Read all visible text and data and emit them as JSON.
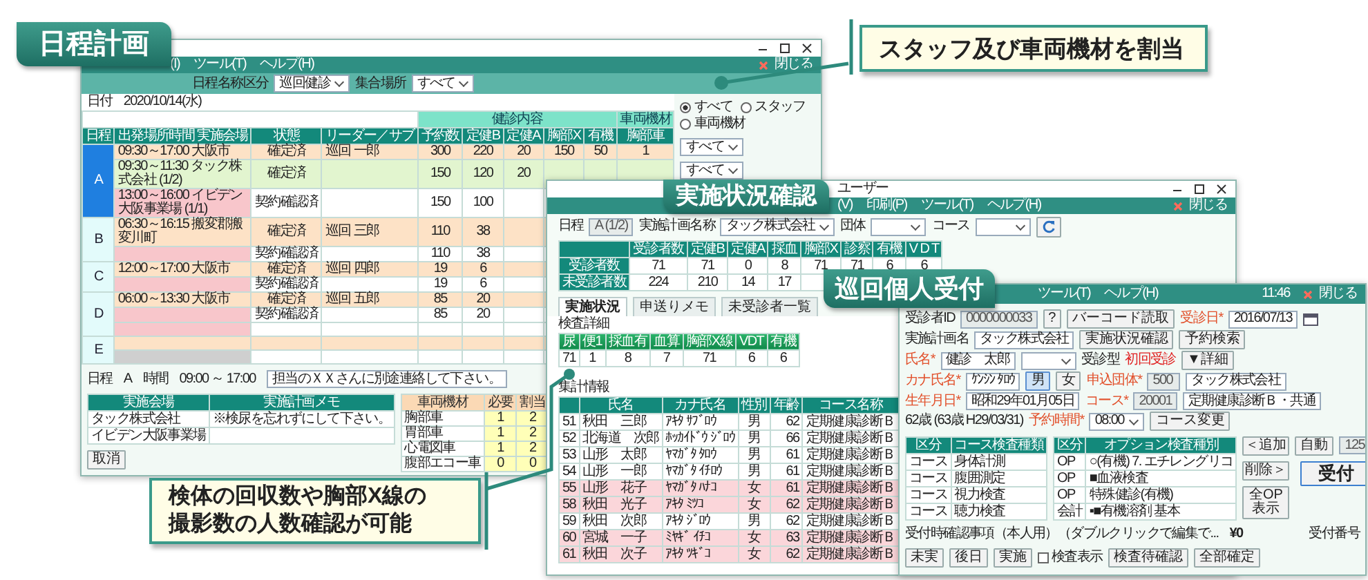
{
  "labels": [
    {
      "text": "日程計画"
    },
    {
      "text": "実施状況確認"
    },
    {
      "text": "巡回個人受付"
    }
  ],
  "callouts": [
    {
      "lines": [
        "スタッフ及び車両機材を割当"
      ]
    },
    {
      "lines": [
        "検体の回収数や胸部X線の",
        "撮影数の人数確認が可能"
      ]
    }
  ],
  "schedule_window": {
    "menu": [
      "(I)",
      "ツール(T)",
      "ヘルプ(H)"
    ],
    "close": "閉じる",
    "toolbar": [
      {
        "kind": "label",
        "text": "日程名称区分"
      },
      {
        "kind": "select",
        "text": "巡回健診"
      },
      {
        "kind": "label",
        "text": "集合場所"
      },
      {
        "kind": "select",
        "text": "すべて"
      }
    ],
    "date_label": "日付",
    "date": "2020/10/14(水)",
    "columns": [
      "日程",
      "出発場所時間 実施会場",
      "状態",
      "リーダー／サブ"
    ],
    "column_groups": [
      {
        "label": "健診内容",
        "columns": [
          "予約数",
          "定健B",
          "定健A",
          "胸部X",
          "有機"
        ]
      },
      {
        "label": "車両機材",
        "columns": [
          "胸部車"
        ]
      }
    ],
    "days": [
      {
        "day": "A",
        "selected": true,
        "rows": [
          {
            "kind": "summary",
            "selected": false,
            "venue": "09:30～17:00 大阪市",
            "status": "確定済",
            "leader": "巡回 一郎",
            "values": [
              "300",
              "220",
              "20",
              "150",
              "50",
              "1"
            ]
          },
          {
            "kind": "plan",
            "selected": true,
            "venue": "09:30～11:30 タック株式会社 (1/2)",
            "status": "確定済",
            "values": [
              "150",
              "120",
              "20"
            ]
          },
          {
            "kind": "plan",
            "selected": false,
            "venue": "13:00～16:00 イビデン大阪事業場 (1/1)",
            "status": "契約確認済",
            "values": [
              "150",
              "100"
            ]
          }
        ]
      },
      {
        "day": "B",
        "selected": false,
        "rows": [
          {
            "kind": "summary",
            "selected": false,
            "venue": "06:30～16:15 搬変郡搬変川町",
            "status": "確定済",
            "leader": "巡回 三郎",
            "values": [
              "110",
              "38"
            ]
          },
          {
            "kind": "plan",
            "selected": false,
            "status": "契約確認済",
            "values": [
              "110",
              "38"
            ]
          }
        ]
      },
      {
        "day": "C",
        "selected": false,
        "rows": [
          {
            "kind": "summary",
            "selected": false,
            "venue": "12:00～17:00 大阪市",
            "status": "確定済",
            "leader": "巡回 四郎",
            "values": [
              "19",
              "6"
            ]
          },
          {
            "kind": "plan",
            "selected": false,
            "status": "契約確認済",
            "values": [
              "19",
              "6"
            ]
          }
        ]
      },
      {
        "day": "D",
        "selected": false,
        "rows": [
          {
            "kind": "summary",
            "selected": false,
            "venue": "06:00～13:30 大阪市",
            "status": "確定済",
            "leader": "巡回 五郎",
            "values": [
              "85",
              "20"
            ]
          },
          {
            "kind": "plan",
            "selected": false,
            "status": "契約確認済",
            "values": [
              "85",
              "20"
            ]
          },
          {
            "kind": "plan",
            "selected": false
          }
        ]
      },
      {
        "day": "E",
        "selected": false,
        "rows": [
          {
            "kind": "summary",
            "selected": false
          },
          {
            "kind": "empty",
            "selected": false
          }
        ]
      }
    ],
    "filter_panel": {
      "radios": [
        {
          "label": "すべて",
          "selected": true
        },
        {
          "label": "スタッフ",
          "selected": false
        },
        {
          "label": "車両機材",
          "selected": false
        }
      ],
      "selects": [
        "すべて",
        "すべて"
      ]
    },
    "info": {
      "day_label": "日程",
      "day": "A",
      "time_label": "時間",
      "time": "09:00 ～ 17:00",
      "memo": "担当のＸＸさんに別途連絡して下さい。"
    },
    "venues": {
      "columns": [
        "実施会場",
        "実施計画メモ"
      ],
      "rows": [
        {
          "venue": "タック株式会社",
          "memo": "※検尿を忘れずにして下さい。"
        },
        {
          "venue": "イビデン大阪事業場"
        }
      ]
    },
    "equipment": {
      "columns": [
        "車両機材",
        "必要",
        "割当"
      ],
      "rows": [
        [
          "胸部車",
          "1",
          "2"
        ],
        [
          "胃部車",
          "1",
          "2"
        ],
        [
          "心電図車",
          "1",
          "2"
        ],
        [
          "腹部エコー車",
          "0",
          "0"
        ]
      ]
    },
    "cancel": "取消"
  },
  "status_window": {
    "title": "ユーザー",
    "menu": [
      "(V)",
      "印刷(P)",
      "ツール(T)",
      "ヘルプ(H)"
    ],
    "close": "閉じる",
    "toolbar": [
      {
        "kind": "label",
        "text": "日程"
      },
      {
        "kind": "readonly",
        "text": "A (1/2)"
      },
      {
        "kind": "label",
        "text": "実施計画名称"
      },
      {
        "kind": "select",
        "text": "タック株式会社"
      },
      {
        "kind": "label",
        "text": "団体"
      },
      {
        "kind": "select"
      },
      {
        "kind": "label",
        "text": "コース"
      },
      {
        "kind": "select"
      },
      {
        "kind": "refresh"
      }
    ],
    "summary": {
      "columns": [
        "受診者数",
        "定健B",
        "定健A",
        "採血",
        "胸部X",
        "診察",
        "有機",
        "V D T"
      ],
      "rows": [
        {
          "label": "受診者数",
          "values": [
            "71",
            "71",
            "0",
            "8",
            "71",
            "71",
            "6",
            "6"
          ]
        },
        {
          "label": "未受診者数",
          "values": [
            "224",
            "210",
            "14",
            "17"
          ]
        }
      ]
    },
    "tabs": [
      {
        "label": "実施状況",
        "selected": true
      },
      {
        "label": "申送りメモ",
        "selected": false
      },
      {
        "label": "未受診者一覧",
        "selected": false
      }
    ],
    "detail": {
      "title": "検査詳細",
      "columns": [
        "尿",
        "便1",
        "採血有",
        "血算",
        "胸部X線",
        "VDT",
        "有機"
      ],
      "values": [
        "71",
        "1",
        "8",
        "7",
        "71",
        "6",
        "6"
      ]
    },
    "aggregate": {
      "title": "集計情報",
      "columns": [
        "氏名",
        "カナ氏名",
        "性別",
        "年齢",
        "コース名称"
      ],
      "rows": [
        {
          "no": "51",
          "name": "秋田　三郎",
          "kana": "ｱｷﾀ ｻﾌﾞﾛｳ",
          "sex": "男",
          "age": "62",
          "course": "定期健康診断Ｂ",
          "highlighted": false
        },
        {
          "no": "52",
          "name": "北海道　次郎",
          "kana": "ﾎｯｶｲﾄﾞｳ ｼﾞﾛｳ",
          "sex": "男",
          "age": "66",
          "course": "定期健康診断Ｂ",
          "highlighted": false
        },
        {
          "no": "53",
          "name": "山形　太郎",
          "kana": "ﾔﾏｶﾞﾀ ﾀﾛｳ",
          "sex": "男",
          "age": "61",
          "course": "定期健康診断Ｂ",
          "highlighted": false
        },
        {
          "no": "54",
          "name": "山形　一郎",
          "kana": "ﾔﾏｶﾞﾀ ｲﾁﾛｳ",
          "sex": "男",
          "age": "61",
          "course": "定期健康診断Ｂ",
          "highlighted": false
        },
        {
          "no": "55",
          "name": "山形　花子",
          "kana": "ﾔﾏｶﾞﾀ ﾊﾅｺ",
          "sex": "女",
          "age": "61",
          "course": "定期健康診断Ｂ",
          "highlighted": true
        },
        {
          "no": "58",
          "name": "秋田　光子",
          "kana": "ｱｷﾀ ﾐﾂｺ",
          "sex": "女",
          "age": "62",
          "course": "定期健康診断Ｂ",
          "highlighted": true
        },
        {
          "no": "59",
          "name": "秋田　次郎",
          "kana": "ｱｷﾀ ｼﾞﾛｳ",
          "sex": "男",
          "age": "62",
          "course": "定期健康診断Ｂ",
          "highlighted": false
        },
        {
          "no": "60",
          "name": "宮城　一子",
          "kana": "ﾐﾔｷﾞ ｲﾁｺ",
          "sex": "女",
          "age": "63",
          "course": "定期健康診断Ｂ",
          "highlighted": true
        },
        {
          "no": "61",
          "name": "秋田　次子",
          "kana": "ｱｷﾀ ﾂｷﾞｺ",
          "sex": "女",
          "age": "62",
          "course": "定期健康診断Ｂ",
          "highlighted": true
        }
      ]
    }
  },
  "reception_window": {
    "menu": [
      "ツール(T)",
      "ヘルプ(H)"
    ],
    "time": "11:46",
    "close": "閉じる",
    "form": [
      [
        {
          "kind": "label",
          "text": "受診者ID"
        },
        {
          "kind": "readonly",
          "text": "0000000033"
        },
        {
          "kind": "button",
          "text": "?"
        },
        {
          "kind": "button",
          "text": "バーコード読取"
        },
        {
          "kind": "req",
          "text": "受診日*"
        },
        {
          "kind": "date",
          "text": "2016/07/13"
        }
      ],
      [
        {
          "kind": "label",
          "text": "実施計画名"
        },
        {
          "kind": "field",
          "text": "タック株式会社"
        },
        {
          "kind": "button",
          "text": "実施状況確認"
        },
        {
          "kind": "button",
          "text": "予約検索"
        }
      ],
      [
        {
          "kind": "req",
          "text": "氏名*"
        },
        {
          "kind": "field",
          "text": "健診　太郎"
        },
        {
          "kind": "select"
        },
        {
          "kind": "label",
          "text": "受診型"
        },
        {
          "kind": "alert",
          "text": "初回受診"
        },
        {
          "kind": "button",
          "text": "▼詳細"
        }
      ],
      [
        {
          "kind": "req",
          "text": "カナ氏名*"
        },
        {
          "kind": "field",
          "text": "ｹﾝｼﾝ ﾀﾛｳ"
        },
        {
          "kind": "toggle",
          "text": "男",
          "selected": true
        },
        {
          "kind": "toggle",
          "text": "女",
          "selected": false
        },
        {
          "kind": "req",
          "text": "申込団体*"
        },
        {
          "kind": "readonly",
          "text": "500"
        },
        {
          "kind": "field",
          "text": "タック株式会社"
        }
      ],
      [
        {
          "kind": "req",
          "text": "生年月日*"
        },
        {
          "kind": "field",
          "text": "昭和29年01月05日"
        },
        {
          "kind": "req",
          "text": "コース*"
        },
        {
          "kind": "readonly",
          "text": "20001"
        },
        {
          "kind": "field",
          "text": "定期健康診断Ｂ・共通"
        }
      ],
      [
        {
          "kind": "text",
          "text": "62歳 (63歳 H29/03/31)"
        },
        {
          "kind": "req",
          "text": "予約時間*"
        },
        {
          "kind": "select",
          "text": "08:00"
        },
        {
          "kind": "button",
          "text": "コース変更"
        }
      ]
    ],
    "course_list": {
      "columns": [
        "区分",
        "コース検査種類"
      ],
      "rows": [
        {
          "cells": [
            "コース",
            "身体計測"
          ],
          "disabled": false
        },
        {
          "cells": [
            "コース",
            "腹囲測定"
          ],
          "disabled": false
        },
        {
          "cells": [
            "コース",
            "視力検査"
          ],
          "disabled": false
        },
        {
          "cells": [
            "コース",
            "聴力検査"
          ],
          "disabled": false
        }
      ]
    },
    "option_list": {
      "columns": [
        "区分",
        "オプション検査種別"
      ],
      "rows": [
        {
          "cells": [
            "OP",
            "○(有機) 7. エチレングリコ"
          ],
          "disabled": false
        },
        {
          "cells": [
            "OP",
            "■血液検査"
          ],
          "disabled": false
        },
        {
          "cells": [
            "OP",
            "特殊健診(有機)"
          ],
          "disabled": false
        },
        {
          "cells": [
            "会計",
            "▪■有機溶剤 基本"
          ],
          "disabled": false
        }
      ]
    },
    "move_buttons": [
      "＜追加",
      "削除＞",
      "全OP表示"
    ],
    "footer": {
      "note": "受付時確認事項（本人用）（ダブルクリックで編集で...",
      "amount": "¥0",
      "buttons": [
        "未実",
        "後日",
        "実施"
      ],
      "check": {
        "label": "検査表示",
        "checked": false
      },
      "check_button": "検査待確認",
      "confirm": "全部確定",
      "number_label": "受付番号",
      "auto": "自動",
      "number": "125",
      "accept": "受付"
    }
  }
}
